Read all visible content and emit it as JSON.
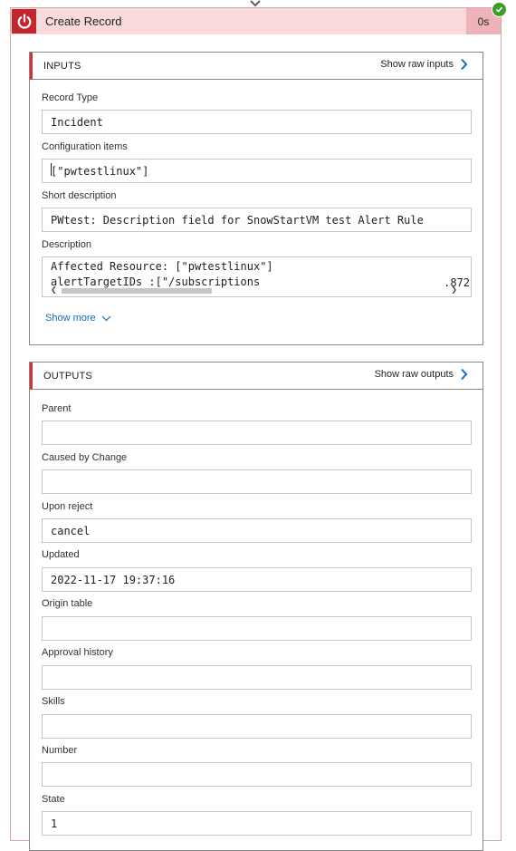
{
  "header": {
    "title": "Create Record",
    "duration": "0s"
  },
  "inputs": {
    "title": "INPUTS",
    "raw_label": "Show raw inputs",
    "fields": {
      "record_type": {
        "label": "Record Type",
        "value": "Incident"
      },
      "config_items": {
        "label": "Configuration items",
        "value": "[\"pwtestlinux\"]"
      },
      "short_desc": {
        "label": "Short description",
        "value": "PWtest: Description field for SnowStartVM test Alert Rule"
      },
      "description": {
        "label": "Description",
        "line1": "Affected Resource: [\"pwtestlinux\"]",
        "line2": "alertTargetIDs :[\"/subscriptions",
        "line2_right": ".872"
      }
    },
    "show_more": "Show more"
  },
  "outputs": {
    "title": "OUTPUTS",
    "raw_label": "Show raw outputs",
    "fields": [
      {
        "label": "Parent",
        "value": ""
      },
      {
        "label": "Caused by Change",
        "value": ""
      },
      {
        "label": "Upon reject",
        "value": "cancel"
      },
      {
        "label": "Updated",
        "value": "2022-11-17 19:37:16"
      },
      {
        "label": "Origin table",
        "value": ""
      },
      {
        "label": "Approval history",
        "value": ""
      },
      {
        "label": "Skills",
        "value": ""
      },
      {
        "label": "Number",
        "value": ""
      },
      {
        "label": "State",
        "value": "1"
      }
    ]
  },
  "colors": {
    "header_bg": "#f8dadc",
    "power_bg": "#c4262e",
    "success": "#3a9e2a",
    "link": "#0f6cbd"
  }
}
